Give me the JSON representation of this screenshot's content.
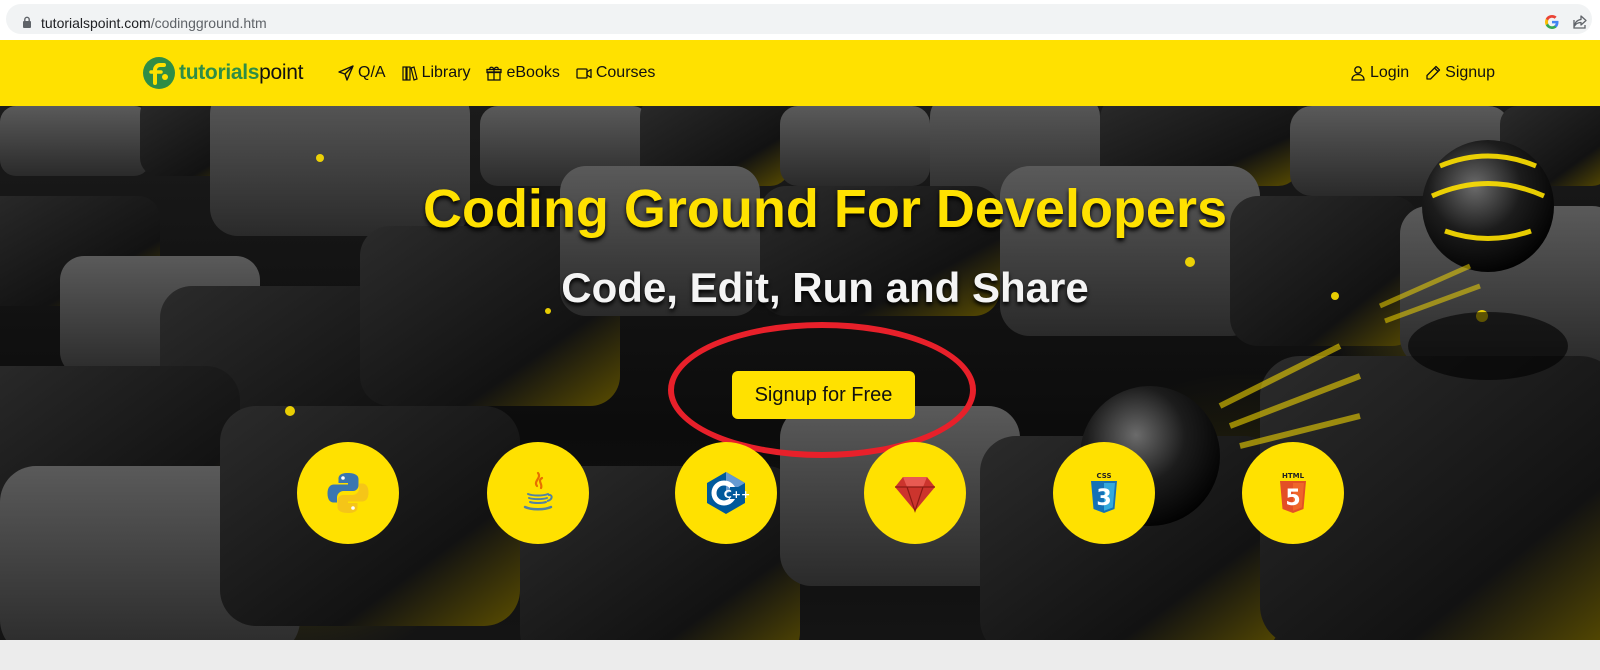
{
  "browser": {
    "url_domain": "tutorialspoint.com",
    "url_path": "/codingground.htm"
  },
  "header": {
    "logo_part1": "tutorials",
    "logo_part2": "point",
    "nav_left": [
      {
        "label": "Q/A",
        "icon": "send-icon"
      },
      {
        "label": "Library",
        "icon": "library-icon"
      },
      {
        "label": "eBooks",
        "icon": "gift-icon"
      },
      {
        "label": "Courses",
        "icon": "video-icon"
      }
    ],
    "nav_right": [
      {
        "label": "Login",
        "icon": "user-icon"
      },
      {
        "label": "Signup",
        "icon": "pencil-icon"
      }
    ]
  },
  "hero": {
    "title": "Coding Ground For Developers",
    "subtitle": "Code, Edit, Run and Share",
    "cta_label": "Signup for Free",
    "languages": [
      {
        "name": "python",
        "icon": "python-icon"
      },
      {
        "name": "java",
        "icon": "java-icon"
      },
      {
        "name": "cpp",
        "icon": "cpp-icon",
        "label": "C++"
      },
      {
        "name": "ruby",
        "icon": "ruby-icon"
      },
      {
        "name": "css3",
        "icon": "css3-icon",
        "label": "CSS",
        "digit": "3"
      },
      {
        "name": "html5",
        "icon": "html5-icon",
        "label": "HTML",
        "digit": "5"
      }
    ]
  },
  "colors": {
    "brand_yellow": "#ffe100",
    "logo_green": "#2f8d46",
    "annotation_red": "#e8202a"
  }
}
